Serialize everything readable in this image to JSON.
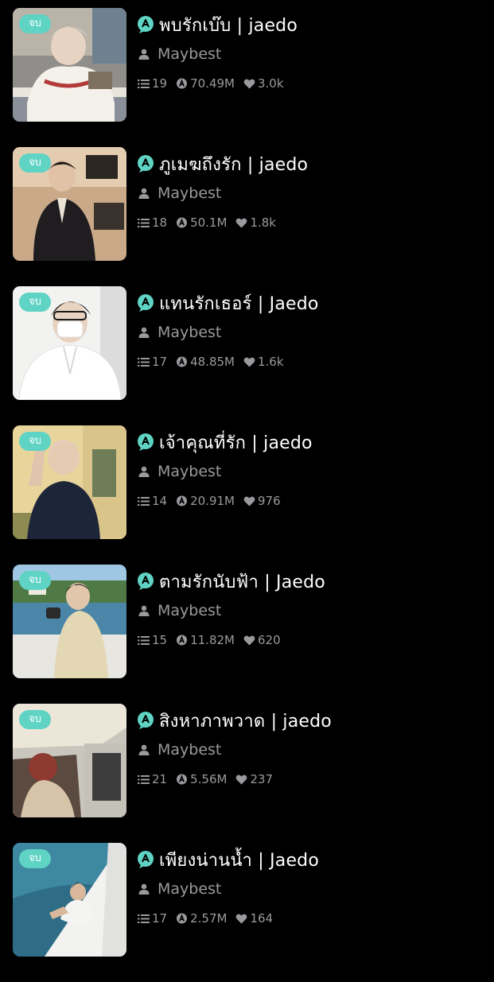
{
  "badge_label": "จบ",
  "colors": {
    "background": "#000000",
    "accent": "#5fd3c4",
    "meta_text": "#9a9a9e",
    "title_text": "#ffffff"
  },
  "icons": {
    "app": "app-logo-icon",
    "author": "user-icon",
    "chapters": "list-icon",
    "views": "views-icon",
    "likes": "heart-icon"
  },
  "stories": [
    {
      "title": "พบรักเบ๊บ | jaedo",
      "author": "Maybest",
      "chapters": "19",
      "views": "70.49M",
      "likes": "3.0k"
    },
    {
      "title": "ภูเมฆถึงรัก | jaedo",
      "author": "Maybest",
      "chapters": "18",
      "views": "50.1M",
      "likes": "1.8k"
    },
    {
      "title": "แทนรักเธอร์ | Jaedo",
      "author": "Maybest",
      "chapters": "17",
      "views": "48.85M",
      "likes": "1.6k"
    },
    {
      "title": "เจ้าคุณที่รัก | jaedo",
      "author": "Maybest",
      "chapters": "14",
      "views": "20.91M",
      "likes": "976"
    },
    {
      "title": "ตามรักนับฟ้า | Jaedo",
      "author": "Maybest",
      "chapters": "15",
      "views": "11.82M",
      "likes": "620"
    },
    {
      "title": "สิงหาภาพวาด | jaedo",
      "author": "Maybest",
      "chapters": "21",
      "views": "5.56M",
      "likes": "237"
    },
    {
      "title": "เพียงน่านน้ำ | Jaedo",
      "author": "Maybest",
      "chapters": "17",
      "views": "2.57M",
      "likes": "164"
    }
  ]
}
